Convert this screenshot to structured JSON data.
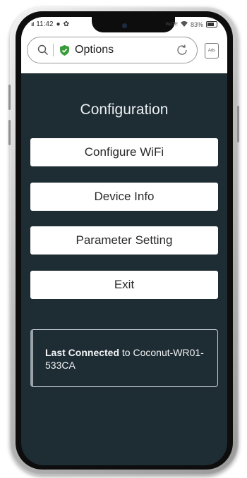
{
  "status_bar": {
    "time": "11:42",
    "signal": "ııl",
    "network_label": "VoLTE",
    "battery_percent": "83%"
  },
  "browser": {
    "page_title": "Options",
    "tabs_button_label": "Ads"
  },
  "main": {
    "heading": "Configuration",
    "buttons": [
      {
        "label": "Configure WiFi"
      },
      {
        "label": "Device Info"
      },
      {
        "label": "Parameter Setting"
      },
      {
        "label": "Exit"
      }
    ]
  },
  "connection_card": {
    "prefix": "Last Connected",
    "suffix": " to Coconut-WR01-533CA"
  },
  "colors": {
    "screen_background": "#1e2c33",
    "shield_green": "#3a9b3a",
    "button_background": "#ffffff"
  },
  "icons": [
    "search-icon",
    "shield-check-icon",
    "reload-icon",
    "wifi-icon",
    "battery-icon"
  ]
}
